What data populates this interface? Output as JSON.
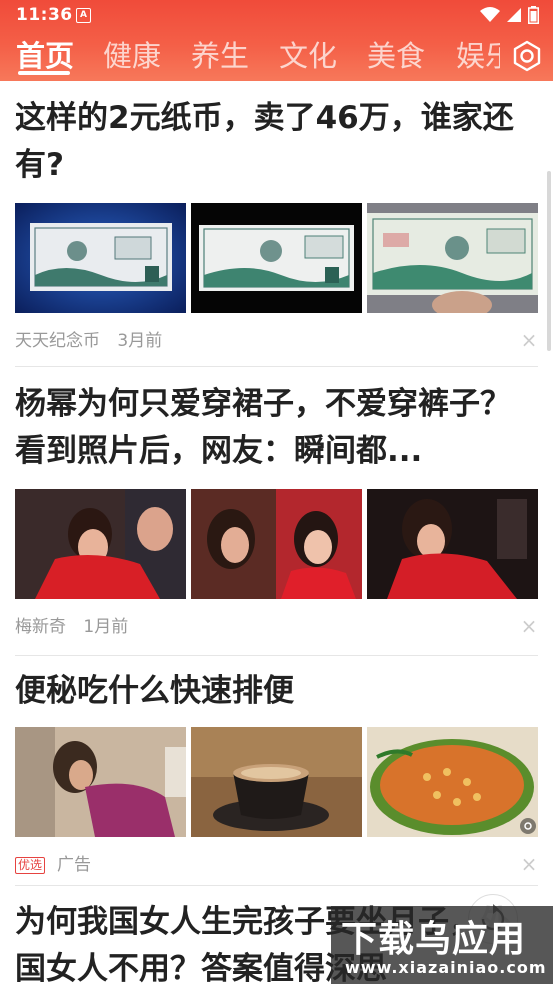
{
  "status_bar": {
    "time": "11:36",
    "notification_badge": "A",
    "icons": [
      "wifi-icon",
      "signal-icon",
      "battery-icon"
    ]
  },
  "tabs": [
    {
      "label": "首页",
      "active": true
    },
    {
      "label": "健康",
      "active": false
    },
    {
      "label": "养生",
      "active": false
    },
    {
      "label": "文化",
      "active": false
    },
    {
      "label": "美食",
      "active": false
    },
    {
      "label": "娱乐",
      "active": false
    }
  ],
  "colors": {
    "header_top": "#f04b3a",
    "header_bottom": "#f7785a",
    "title_text": "#222222",
    "meta_text": "#999999",
    "ad_tag": "#e64340"
  },
  "articles": [
    {
      "title": "这样的2元纸币，卖了46万，谁家还有?",
      "source": "天天纪念币",
      "time": "3月前",
      "images": [
        "banknote-photo-blue-background",
        "banknote-photo-black-background",
        "banknote-photo-held-in-hand"
      ]
    },
    {
      "title": "杨幂为何只爱穿裙子，不爱穿裤子？看到照片后，网友：瞬间都...",
      "source": "梅新奇",
      "time": "1月前",
      "images": [
        "woman-red-dress-photo-1",
        "woman-red-dress-photo-2",
        "woman-red-dress-photo-3"
      ]
    },
    {
      "title": "便秘吃什么快速排便",
      "ad_tag": "优选",
      "source": "广告",
      "images": [
        "woman-photo",
        "coffee-cup-photo",
        "beans-pan-photo"
      ]
    },
    {
      "title": "为何我国女人生完孩子要坐月子，外国女人不用？答案值得深思"
    }
  ],
  "watermark": {
    "main": "下载乌应用",
    "sub": "www.xiazainiao.com"
  }
}
